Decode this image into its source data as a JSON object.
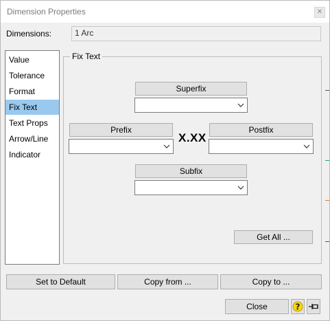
{
  "window": {
    "title": "Dimension Properties",
    "close_glyph": "✕"
  },
  "dimensions": {
    "label": "Dimensions:",
    "value": "1 Arc"
  },
  "nav": {
    "items": [
      {
        "label": "Value"
      },
      {
        "label": "Tolerance"
      },
      {
        "label": "Format"
      },
      {
        "label": "Fix Text",
        "selected": true
      },
      {
        "label": "Text Props"
      },
      {
        "label": "Arrow/Line"
      },
      {
        "label": "Indicator"
      }
    ]
  },
  "fix_text": {
    "group_title": "Fix Text",
    "superfix": {
      "label": "Superfix",
      "value": ""
    },
    "prefix": {
      "label": "Prefix",
      "value": ""
    },
    "postfix": {
      "label": "Postfix",
      "value": ""
    },
    "subfix": {
      "label": "Subfix",
      "value": ""
    },
    "sample": "X.XX",
    "get_all_label": "Get All ..."
  },
  "actions": {
    "set_default": "Set to Default",
    "copy_from": "Copy from ...",
    "copy_to": "Copy to ..."
  },
  "footer": {
    "close": "Close",
    "help_icon": "help-icon",
    "pin_icon": "pin-icon"
  },
  "colors": {
    "selection": "#99c9ef",
    "help_yellow": "#ffd800"
  }
}
